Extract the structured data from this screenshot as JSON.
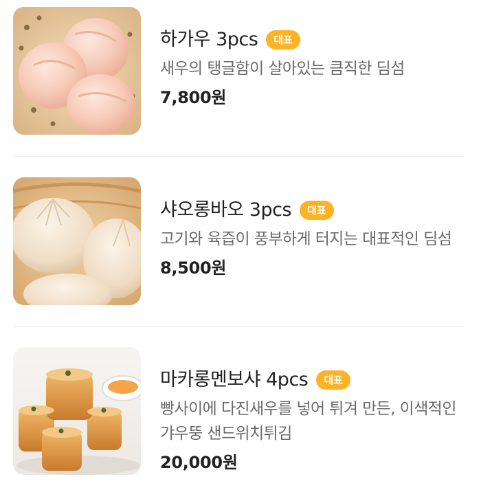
{
  "menu": {
    "items": [
      {
        "name": "하가우 3pcs",
        "badge": "대표",
        "description": "새우의 탱글함이 살아있는 큼직한 딤섬",
        "price": "7,800원",
        "image_icon": "har-gow-dumpling-image"
      },
      {
        "name": "샤오롱바오 3pcs",
        "badge": "대표",
        "description": "고기와 육즙이 풍부하게 터지는 대표적인 딤섬",
        "price": "8,500원",
        "image_icon": "xiaolongbao-dumpling-image"
      },
      {
        "name": "마카롱멘보샤 4pcs",
        "badge": "대표",
        "description": "빵사이에 다진새우를 넣어 튀겨 만든, 이색적인 갸우뚱 샌드위치튀김",
        "price": "20,000원",
        "image_icon": "shrimp-toast-image"
      }
    ]
  },
  "colors": {
    "badge": "#ffb224",
    "title": "#222222",
    "description": "#6b6b6b",
    "divider": "#ececec"
  }
}
